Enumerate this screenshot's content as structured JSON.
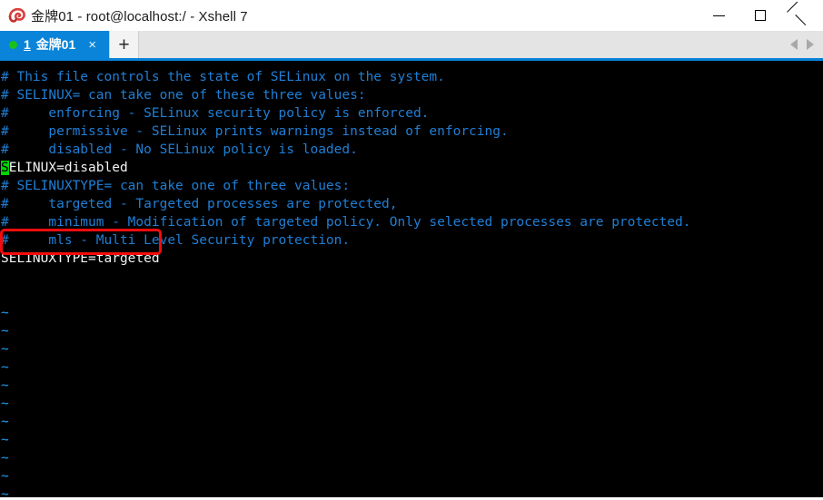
{
  "window": {
    "title": "金牌01 - root@localhost:/ - Xshell 7",
    "icon": "xshell-shell-icon",
    "controls": {
      "minimize": "minimize-icon",
      "maximize": "maximize-icon",
      "close": "close-icon"
    }
  },
  "tabbar": {
    "tabs": [
      {
        "index": "1",
        "label": "金牌01",
        "status_dot_color": "#19c219",
        "close_label": "×",
        "active": true
      }
    ],
    "new_tab_label": "+",
    "nav_left": "scroll-tabs-left-icon",
    "nav_right": "scroll-tabs-right-icon",
    "accent_color": "#0a84d8"
  },
  "terminal": {
    "background": "#000000",
    "comment_color": "#1f7fd6",
    "text_color": "#f2f2f2",
    "tilde_color": "#1f9ef5",
    "cursor_color": "#00d400",
    "cursor_char": "S",
    "lines": [
      {
        "text": "# This file controls the state of SELinux on the system.",
        "style": "comment"
      },
      {
        "text": "# SELINUX= can take one of these three values:",
        "style": "comment"
      },
      {
        "text": "#     enforcing - SELinux security policy is enforced.",
        "style": "comment"
      },
      {
        "text": "#     permissive - SELinux prints warnings instead of enforcing.",
        "style": "comment"
      },
      {
        "text": "#     disabled - No SELinux policy is loaded.",
        "style": "comment"
      },
      {
        "text": "SELINUX=disabled",
        "style": "plain",
        "cursor_at": 0,
        "highlighted": true
      },
      {
        "text": "# SELINUXTYPE= can take one of three values:",
        "style": "comment"
      },
      {
        "text": "#     targeted - Targeted processes are protected,",
        "style": "comment"
      },
      {
        "text": "#     minimum - Modification of targeted policy. Only selected processes are protected.",
        "style": "comment"
      },
      {
        "text": "#     mls - Multi Level Security protection.",
        "style": "comment"
      },
      {
        "text": "SELINUXTYPE=targeted",
        "style": "plain"
      },
      {
        "text": "",
        "style": "plain"
      },
      {
        "text": "",
        "style": "plain"
      },
      {
        "text": "~",
        "style": "tilde"
      },
      {
        "text": "~",
        "style": "tilde"
      },
      {
        "text": "~",
        "style": "tilde"
      },
      {
        "text": "~",
        "style": "tilde"
      },
      {
        "text": "~",
        "style": "tilde"
      },
      {
        "text": "~",
        "style": "tilde"
      },
      {
        "text": "~",
        "style": "tilde"
      },
      {
        "text": "~",
        "style": "tilde"
      },
      {
        "text": "~",
        "style": "tilde"
      },
      {
        "text": "~",
        "style": "tilde"
      },
      {
        "text": "~",
        "style": "tilde"
      }
    ],
    "highlight_box_color": "#f50c0c"
  }
}
